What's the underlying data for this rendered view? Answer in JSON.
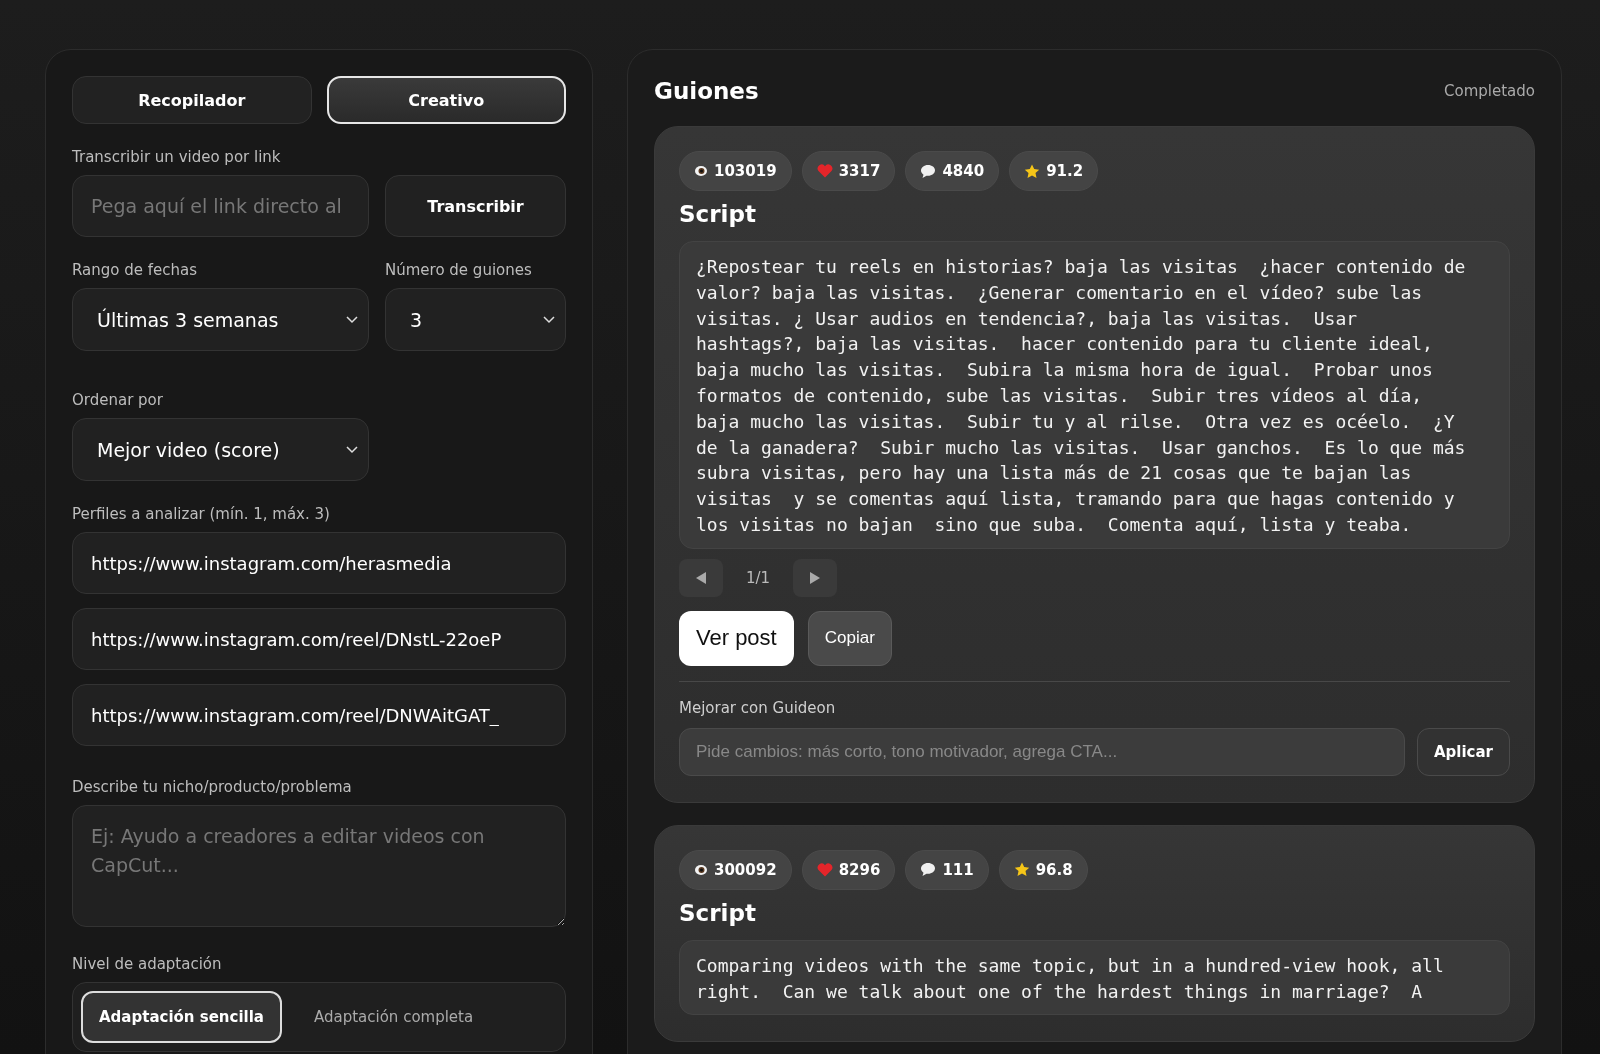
{
  "mode_tabs": [
    {
      "label": "Recopilador",
      "selected": false
    },
    {
      "label": "Creativo",
      "selected": true
    }
  ],
  "transcribe": {
    "label": "Transcribir un video por link",
    "placeholder": "Pega aquí el link directo al",
    "button": "Transcribir"
  },
  "date_range": {
    "label": "Rango de fechas",
    "value": "Últimas 3 semanas"
  },
  "script_count": {
    "label": "Número de guiones",
    "value": "3"
  },
  "sort": {
    "label": "Ordenar por",
    "value": "Mejor video (score)"
  },
  "profiles": {
    "label": "Perfiles a analizar (mín. 1, máx. 3)",
    "urls": [
      "https://www.instagram.com/herasmedia",
      "https://www.instagram.com/reel/DNstL-22oeP",
      "https://www.instagram.com/reel/DNWAitGAT_"
    ]
  },
  "niche": {
    "label": "Describe tu nicho/producto/problema",
    "placeholder": "Ej: Ayudo a creadores a editar videos con CapCut..."
  },
  "adaptation": {
    "label": "Nivel de adaptación",
    "options": [
      {
        "label": "Adaptación sencilla",
        "selected": true
      },
      {
        "label": "Adaptación completa",
        "selected": false
      }
    ]
  },
  "scripts_panel": {
    "title": "Guiones",
    "status": "Completado",
    "cards": [
      {
        "stats": [
          {
            "kind": "views",
            "value": "103019"
          },
          {
            "kind": "likes",
            "value": "3317"
          },
          {
            "kind": "comments",
            "value": "4840"
          },
          {
            "kind": "score",
            "value": "91.2"
          }
        ],
        "heading": "Script",
        "text": "¿Repostear tu reels en historias? baja las visitas  ¿hacer contenido de valor? baja las visitas.  ¿Generar comentario en el vídeo? sube las visitas. ¿ Usar audios en tendencia?, baja las visitas.  Usar hashtags?, baja las visitas.  hacer contenido para tu cliente ideal, baja mucho las visitas.  Subira la misma hora de igual.  Probar unos formatos de contenido, sube las visitas.  Subir tres vídeos al día, baja mucho las visitas.  Subir tu y al rilse.  Otra vez es océelo.  ¿Y de la ganadera?  Subir mucho las visitas.  Usar ganchos.  Es lo que más subra visitas, pero hay una lista más de 21 cosas que te bajan las visitas  y se comentas aquí lista, tramando para que hagas contenido y los visitas no bajan  sino que suba.  Comenta aquí, lista y teaba.",
        "pager": "1/1",
        "primary_button": "Ver post",
        "secondary_button": "Copiar",
        "improve_label": "Mejorar con Guideon",
        "improve_placeholder": "Pide cambios: más corto, tono motivador, agrega CTA...",
        "apply_button": "Aplicar"
      },
      {
        "stats": [
          {
            "kind": "views",
            "value": "300092"
          },
          {
            "kind": "likes",
            "value": "8296"
          },
          {
            "kind": "comments",
            "value": "111"
          },
          {
            "kind": "score",
            "value": "96.8"
          }
        ],
        "heading": "Script",
        "text": "Comparing videos with the same topic, but in a hundred-view hook, all right.  Can we talk about one of the hardest things in marriage?  A"
      }
    ]
  }
}
